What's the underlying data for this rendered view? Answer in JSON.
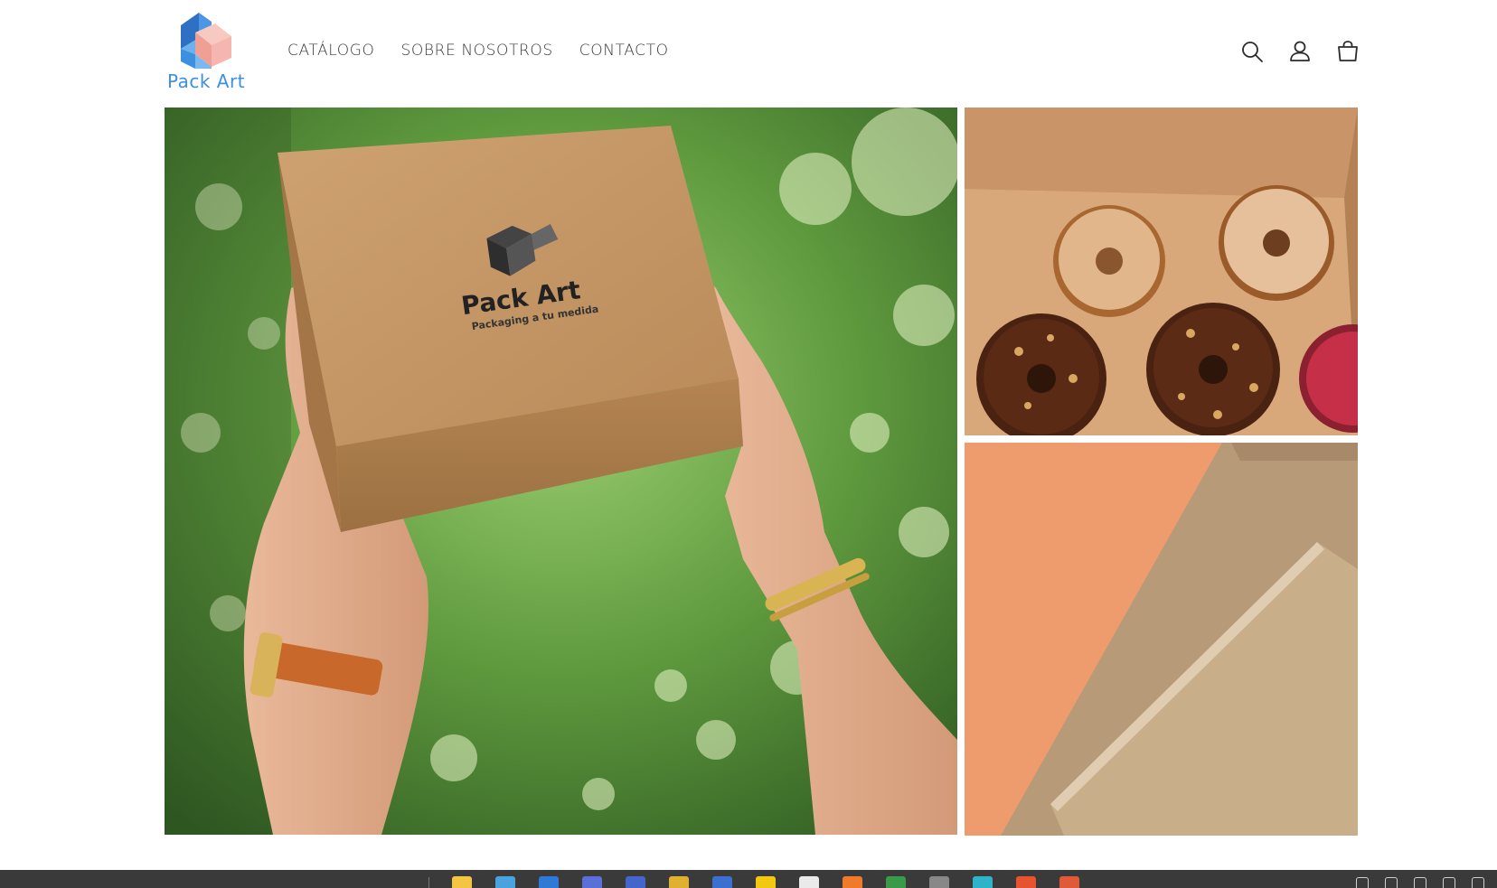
{
  "brand": {
    "name": "Pack Art",
    "colors": {
      "blue": "#3d8fe0",
      "pink": "#f4b6ae",
      "dark_blue": "#2f6fc4"
    }
  },
  "nav": {
    "items": [
      {
        "label": "CATÁLOGO"
      },
      {
        "label": "SOBRE NOSOTROS"
      },
      {
        "label": "CONTACTO"
      }
    ]
  },
  "header_icons": [
    "search-icon",
    "account-icon",
    "cart-icon"
  ],
  "gallery": {
    "main_box": {
      "brand": "Pack Art",
      "tagline": "Packaging a tu medida"
    }
  },
  "taskbar": {
    "app_colors": [
      "#f4c542",
      "#4aa3df",
      "#2f7ad6",
      "#5a6fd8",
      "#4466cc",
      "#e0b030",
      "#3b6fd0",
      "#f2c811",
      "#eaeaea",
      "#f07a2a",
      "#3a9a4a",
      "#888888",
      "#2fb3c8",
      "#e8532f",
      "#e05a3a"
    ],
    "tray_icons": [
      "chevron-up-icon",
      "tablet-icon",
      "network-icon",
      "wifi-icon",
      "volume-icon"
    ]
  }
}
